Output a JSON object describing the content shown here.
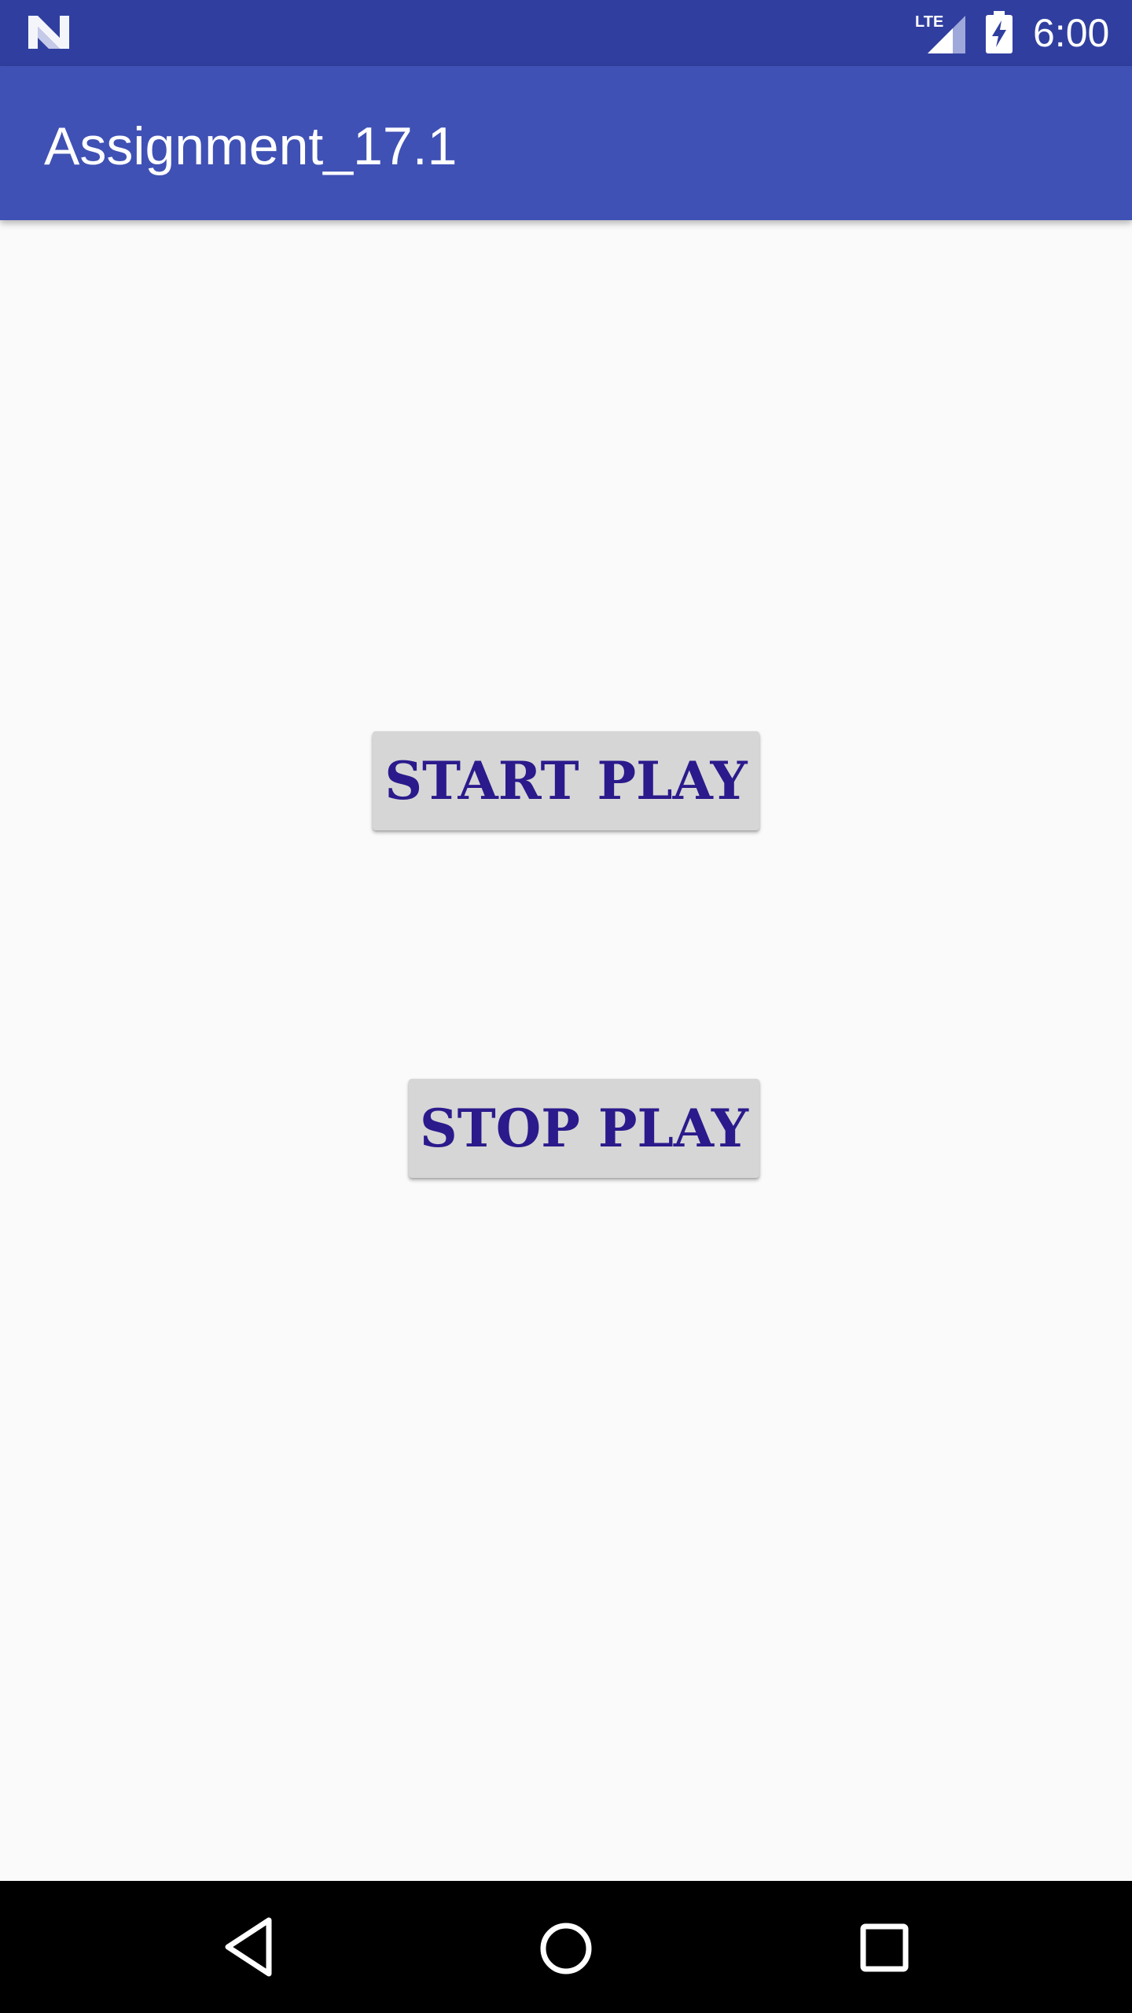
{
  "status_bar": {
    "time": "6:00",
    "network_label": "LTE",
    "icons": [
      "android-n-icon",
      "lte-signal-icon",
      "battery-charging-icon"
    ],
    "background": "#303f9f"
  },
  "app_bar": {
    "title": "Assignment_17.1",
    "background": "#3f51b5"
  },
  "main": {
    "start_button_label": "START PLAY",
    "stop_button_label": "STOP PLAY",
    "button_text_color": "#2a1a8c",
    "button_background": "#d6d6d6"
  },
  "nav_bar": {
    "icons": [
      "back-icon",
      "home-icon",
      "recents-icon"
    ]
  }
}
